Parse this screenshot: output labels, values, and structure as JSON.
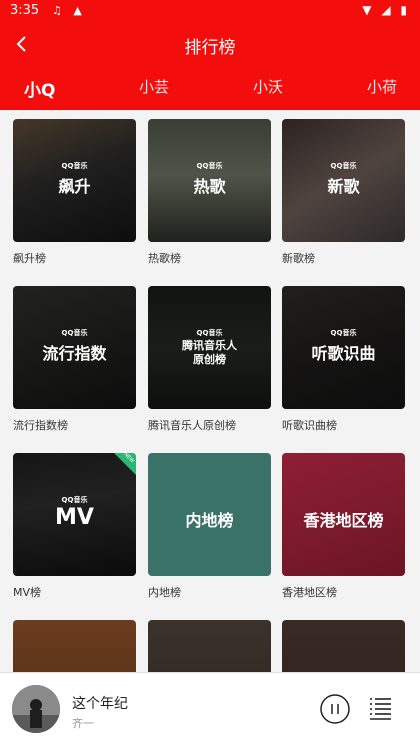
{
  "status": {
    "time": "3:35",
    "left_icons": "♫ ▲",
    "right_icons": "▼ ◢ ▮"
  },
  "header": {
    "title": "排行榜"
  },
  "tabs": [
    {
      "label": "小Q"
    },
    {
      "label": "小芸"
    },
    {
      "label": "小沃"
    },
    {
      "label": "小荷"
    }
  ],
  "qq_tag": "QQ音乐",
  "charts": [
    {
      "cover_title": "飙升",
      "label": "飙升榜"
    },
    {
      "cover_title": "热歌",
      "label": "热歌榜"
    },
    {
      "cover_title": "新歌",
      "label": "新歌榜"
    },
    {
      "cover_title": "流行指数",
      "label": "流行指数榜"
    },
    {
      "cover_title": "腾讯音乐人原创榜",
      "label": "腾讯音乐人原创榜"
    },
    {
      "cover_title": "听歌识曲",
      "label": "听歌识曲榜"
    },
    {
      "cover_title": "MV",
      "label": "MV榜"
    },
    {
      "cover_title": "内地榜",
      "label": "内地榜"
    },
    {
      "cover_title": "香港地区榜",
      "label": "香港地区榜"
    }
  ],
  "corner_tag": "NEW",
  "player": {
    "song": "这个年纪",
    "artist": "齐一"
  },
  "colors": {
    "brand_red": "#f40d0d",
    "tag_green": "#2bb673"
  }
}
